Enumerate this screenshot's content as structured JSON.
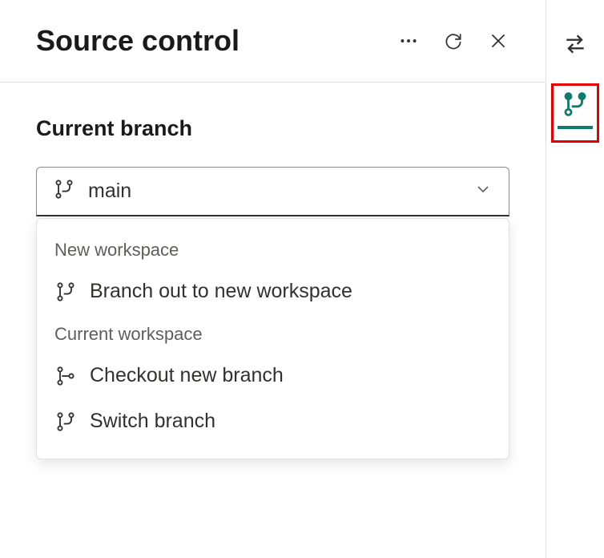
{
  "header": {
    "title": "Source control"
  },
  "section": {
    "label": "Current branch",
    "selected_value": "main"
  },
  "dropdown": {
    "groups": [
      {
        "label": "New workspace",
        "items": [
          {
            "label": "Branch out to new workspace"
          }
        ]
      },
      {
        "label": "Current workspace",
        "items": [
          {
            "label": "Checkout new branch"
          },
          {
            "label": "Switch branch"
          }
        ]
      }
    ]
  },
  "colors": {
    "accent": "#0f7b6c",
    "highlight_border": "#e60000"
  }
}
